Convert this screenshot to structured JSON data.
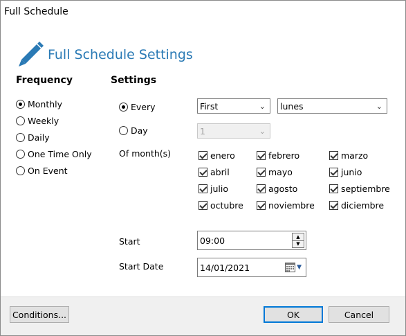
{
  "window": {
    "title": "Full Schedule"
  },
  "header": {
    "title": "Full Schedule Settings"
  },
  "frequency": {
    "title": "Frequency",
    "options": [
      {
        "label": "Monthly",
        "selected": true
      },
      {
        "label": "Weekly",
        "selected": false
      },
      {
        "label": "Daily",
        "selected": false
      },
      {
        "label": "One Time Only",
        "selected": false
      },
      {
        "label": "On Event",
        "selected": false
      }
    ]
  },
  "settings": {
    "title": "Settings",
    "every_label": "Every",
    "every_selected": true,
    "ordinal_value": "First",
    "weekday_value": "lunes",
    "day_label": "Day",
    "day_selected": false,
    "day_value": "1",
    "months_label": "Of month(s)",
    "months": [
      {
        "label": "enero",
        "checked": true
      },
      {
        "label": "febrero",
        "checked": true
      },
      {
        "label": "marzo",
        "checked": true
      },
      {
        "label": "abril",
        "checked": true
      },
      {
        "label": "mayo",
        "checked": true
      },
      {
        "label": "junio",
        "checked": true
      },
      {
        "label": "julio",
        "checked": true
      },
      {
        "label": "agosto",
        "checked": true
      },
      {
        "label": "septiembre",
        "checked": true
      },
      {
        "label": "octubre",
        "checked": true
      },
      {
        "label": "noviembre",
        "checked": true
      },
      {
        "label": "diciembre",
        "checked": true
      }
    ],
    "start_label": "Start",
    "start_value": "09:00",
    "start_date_label": "Start Date",
    "start_date_value": "14/01/2021"
  },
  "footer": {
    "conditions_label": "Conditions...",
    "ok_label": "OK",
    "cancel_label": "Cancel"
  },
  "colors": {
    "accent": "#2a7ab5",
    "default_button_border": "#0078d7"
  },
  "icons": {
    "header": "pencil-icon",
    "calendar": "calendar-icon"
  }
}
